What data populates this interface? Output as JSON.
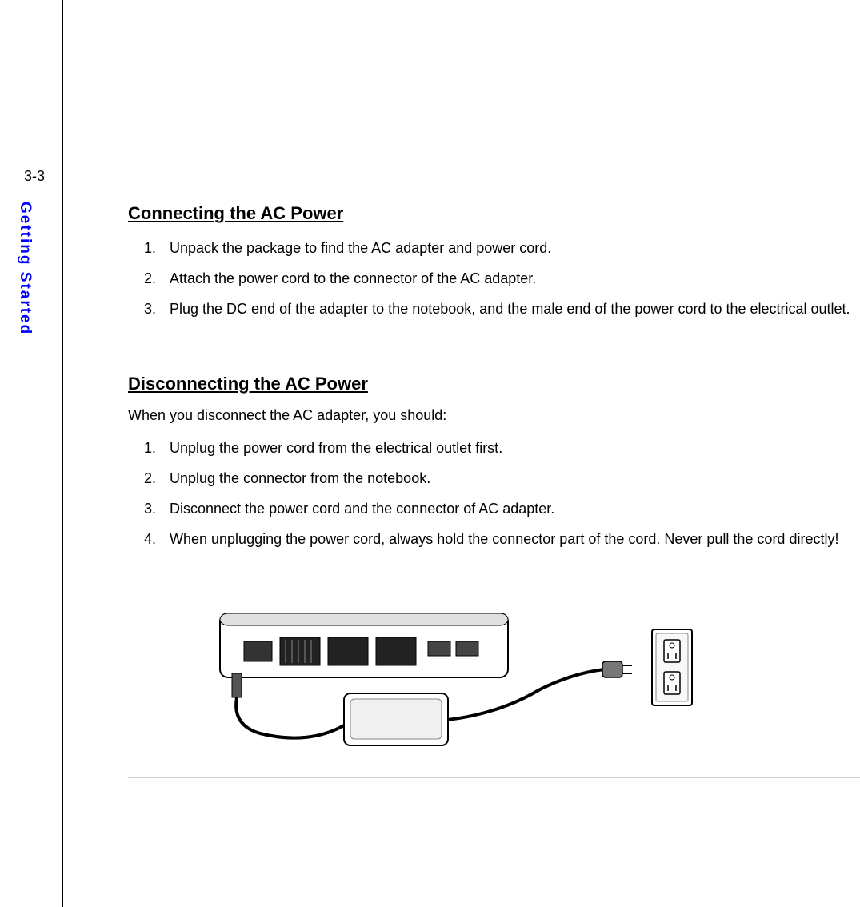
{
  "page_number": "3-3",
  "sidebar_label": "Getting Started",
  "section1": {
    "heading": "Connecting the AC Power",
    "items": [
      "Unpack the package to find the AC adapter and power cord.",
      "Attach the power cord to the connector of the AC adapter.",
      "Plug the DC end of the adapter to the notebook, and the male end of the power cord to the electrical outlet."
    ]
  },
  "section2": {
    "heading": "Disconnecting the AC Power",
    "intro": "When you disconnect the AC adapter, you should:",
    "items": [
      "Unplug the power cord from the electrical outlet first.",
      "Unplug the connector from the notebook.",
      "Disconnect the power cord and the connector of AC adapter.",
      "When unplugging the power cord, always hold the connector part of the cord. Never pull the cord directly!"
    ]
  }
}
